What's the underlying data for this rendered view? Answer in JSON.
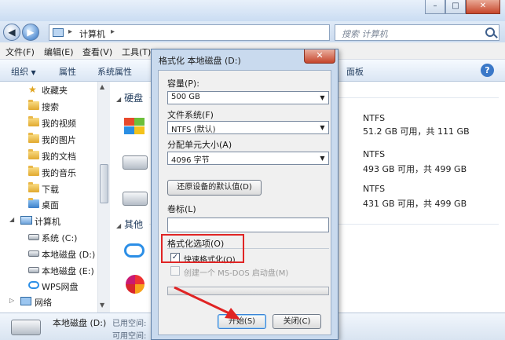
{
  "explorer": {
    "address": {
      "crumb": "计算机"
    },
    "search": {
      "placeholder": "搜索 计算机"
    },
    "menu": [
      "文件(F)",
      "编辑(E)",
      "查看(V)",
      "工具(T)"
    ],
    "toolbar": {
      "organize": "组织",
      "properties": "属性",
      "system_properties": "系统属性",
      "control_panel": "面板"
    },
    "nav": {
      "favorites": "收藏夹",
      "search": "搜索",
      "videos": "我的视频",
      "pictures": "我的图片",
      "documents": "我的文档",
      "music": "我的音乐",
      "downloads": "下载",
      "desktop": "桌面",
      "computer": "计算机",
      "system_c": "系统 (C:)",
      "local_d": "本地磁盘 (D:)",
      "local_e": "本地磁盘 (E:)",
      "wps": "WPS网盘",
      "network": "网络"
    },
    "content": {
      "group_hard_disks": "硬盘",
      "group_other": "其他",
      "drives": [
        {
          "fs": "NTFS",
          "free": "51.2 GB 可用，共 111 GB"
        },
        {
          "fs": "NTFS",
          "free": "493 GB 可用，共 499 GB"
        },
        {
          "fs": "NTFS",
          "free": "431 GB 可用，共 499 GB"
        }
      ]
    },
    "details": {
      "name": "本地磁盘 (D:)",
      "used_label": "已用空间:",
      "total_label": "可用空间:"
    }
  },
  "dialog": {
    "title": "格式化 本地磁盘 (D:)",
    "close_glyph": "✕",
    "capacity_label": "容量(P):",
    "capacity_value": "500 GB",
    "filesystem_label": "文件系统(F)",
    "filesystem_value": "NTFS (默认)",
    "alloc_label": "分配单元大小(A)",
    "alloc_value": "4096 字节",
    "restore_button": "还原设备的默认值(D)",
    "volume_label": "卷标(L)",
    "volume_value": "",
    "options_label": "格式化选项(O)",
    "quick_format_label": "快速格式化(Q)",
    "quick_format_checked": true,
    "msdos_label": "创建一个 MS-DOS 启动盘(M)",
    "progress": 0,
    "start_button": "开始(S)",
    "close_button": "关闭(C)"
  },
  "colors": {
    "annotation_red": "#e02424"
  }
}
